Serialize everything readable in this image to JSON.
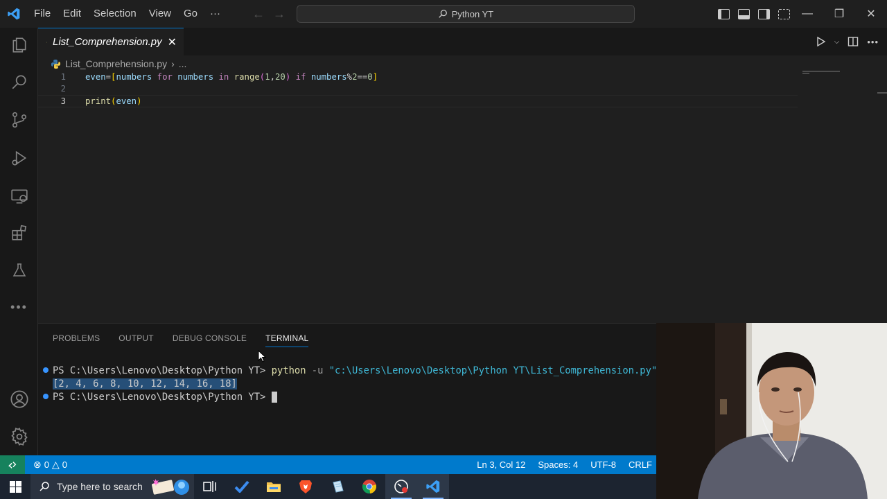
{
  "titlebar": {
    "menu": [
      "File",
      "Edit",
      "Selection",
      "View",
      "Go",
      "···"
    ],
    "command_center": "Python YT",
    "window_controls": [
      "minimize-icon",
      "restore-icon",
      "close-icon"
    ]
  },
  "activity_bar": {
    "icons": [
      "explorer-icon",
      "search-icon",
      "source-control-icon",
      "run-debug-icon",
      "remote-explorer-icon",
      "extensions-icon",
      "testing-icon",
      "more-icon",
      "accounts-icon",
      "manage-gear-icon"
    ]
  },
  "editor": {
    "tab_label": "List_Comprehension.py",
    "breadcrumb_file": "List_Comprehension.py",
    "breadcrumb_more": "...",
    "line_numbers": [
      "1",
      "2",
      "3"
    ],
    "code": {
      "l1_var": "even",
      "l1_eq": "=",
      "l1_open": "[",
      "l1_numbers1": "numbers",
      "l1_for": "for",
      "l1_numbers2": "numbers",
      "l1_in": "in",
      "l1_range": "range",
      "l1_p_open": "(",
      "l1_n1": "1",
      "l1_comma": ",",
      "l1_n20": "20",
      "l1_p_close": ")",
      "l1_if": "if",
      "l1_numbers3": "numbers",
      "l1_mod": "%",
      "l1_n2": "2",
      "l1_eqeq": "==",
      "l1_n0": "0",
      "l1_close": "]",
      "l3_print": "print",
      "l3_open": "(",
      "l3_even": "even",
      "l3_close": ")"
    }
  },
  "panel": {
    "tabs": [
      "PROBLEMS",
      "OUTPUT",
      "DEBUG CONSOLE",
      "TERMINAL"
    ],
    "active_tab": "TERMINAL",
    "terminal": {
      "prompt1": "PS C:\\Users\\Lenovo\\Desktop\\Python YT> ",
      "cmd": "python",
      "flag": " -u ",
      "path": "\"c:\\Users\\Lenovo\\Desktop\\Python YT\\List_Comprehension.py\"",
      "output": "[2, 4, 6, 8, 10, 12, 14, 16, 18]",
      "prompt2": "PS C:\\Users\\Lenovo\\Desktop\\Python YT> "
    }
  },
  "statusbar": {
    "errors": "0",
    "warnings": "0",
    "position": "Ln 3, Col 12",
    "spaces": "Spaces: 4",
    "encoding": "UTF-8",
    "eol": "CRLF"
  },
  "taskbar": {
    "search_placeholder": "Type here to search",
    "apps": [
      "task-view-icon",
      "todo-icon",
      "file-explorer-icon",
      "brave-browser-icon",
      "notepad-icon",
      "chrome-icon",
      "screen-recorder-icon",
      "vscode-icon"
    ]
  },
  "colors": {
    "accent": "#007acc",
    "remote": "#16825d",
    "tab_border": "#0078d4"
  }
}
